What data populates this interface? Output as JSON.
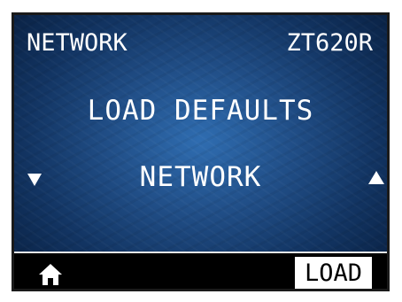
{
  "header": {
    "menu_name": "NETWORK",
    "printer_model": "ZT620R"
  },
  "menu": {
    "title": "LOAD DEFAULTS",
    "value": "NETWORK"
  },
  "navigation": {
    "down_icon": "triangle-down-icon",
    "up_icon": "triangle-up-icon"
  },
  "softkeys": {
    "home_icon": "home-icon",
    "load_label": "LOAD"
  },
  "colors": {
    "screen_center": "#2f6db1",
    "screen_edge": "#081e3e",
    "softkey_bar": "#000000",
    "text": "#ffffff"
  }
}
